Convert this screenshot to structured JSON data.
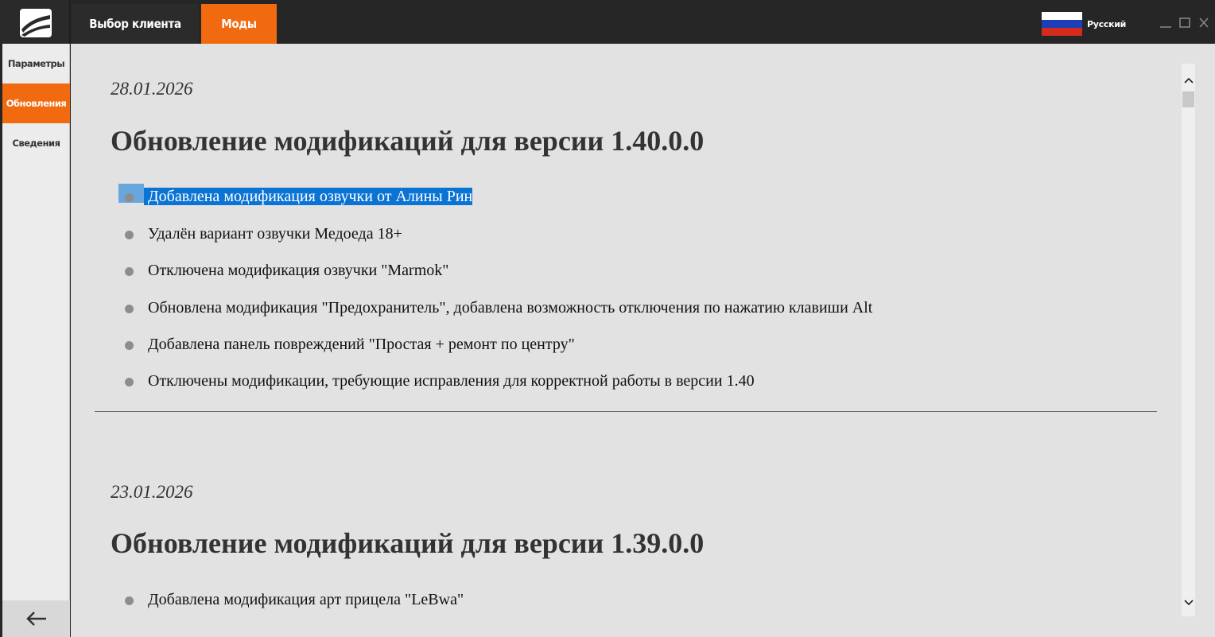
{
  "header": {
    "tabs": [
      {
        "label": "Выбор клиента",
        "active": false
      },
      {
        "label": "Моды",
        "active": true
      }
    ],
    "language": {
      "label": "Русский",
      "flag_colors": [
        "#ffffff",
        "#1c3fb8",
        "#d52b1e"
      ]
    },
    "window_controls": {
      "minimize": "—",
      "maximize": "☐",
      "close": "✕"
    },
    "accent_color": "#f26a10"
  },
  "sidebar": {
    "items": [
      {
        "label": "Параметры",
        "active": false
      },
      {
        "label": "Обновления",
        "active": true
      },
      {
        "label": "Сведения",
        "active": false
      }
    ],
    "back_icon": "arrow-left-icon"
  },
  "updates": [
    {
      "date": "28.01.2026",
      "title": "Обновление модификаций для версии 1.40.0.0",
      "items": [
        "Добавлена модификация озвучки от Алины Рин",
        "Удалён вариант озвучки Медоеда 18+",
        "Отключена модификация озвучки \"Marmok\"",
        "Обновлена модификация \"Предохранитель\", добавлена возможность отключения по нажатию клавиши Alt",
        "Добавлена панель повреждений \"Простая + ремонт по центру\"",
        "Отключены модификации, требующие исправления для корректной работы в версии 1.40"
      ]
    },
    {
      "date": "23.01.2026",
      "title": "Обновление модификаций для версии 1.39.0.0",
      "items": [
        "Добавлена модификация арт прицела \"LeBwa\""
      ]
    }
  ]
}
